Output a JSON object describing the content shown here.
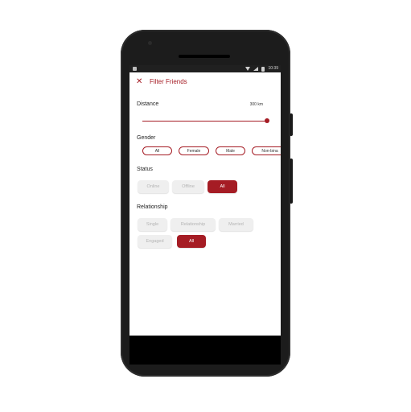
{
  "status_bar": {
    "time": "10:39"
  },
  "header": {
    "close_icon": "close-icon",
    "title": "Filter Friends"
  },
  "distance": {
    "label": "Distance",
    "value": "300 km",
    "slider_fraction": 1.0
  },
  "gender": {
    "label": "Gender",
    "options": [
      "All",
      "Female",
      "Male",
      "Non-bina"
    ]
  },
  "status": {
    "label": "Status",
    "options": [
      "Online",
      "Offline",
      "All"
    ],
    "selected": "All"
  },
  "relationship": {
    "label": "Relationship",
    "options": [
      "Single",
      "Relationship",
      "Married",
      "Engaged",
      "All"
    ],
    "selected": "All"
  },
  "colors": {
    "accent": "#a51c24",
    "pill_bg": "#efefef",
    "pill_text": "#b4b4b4"
  }
}
